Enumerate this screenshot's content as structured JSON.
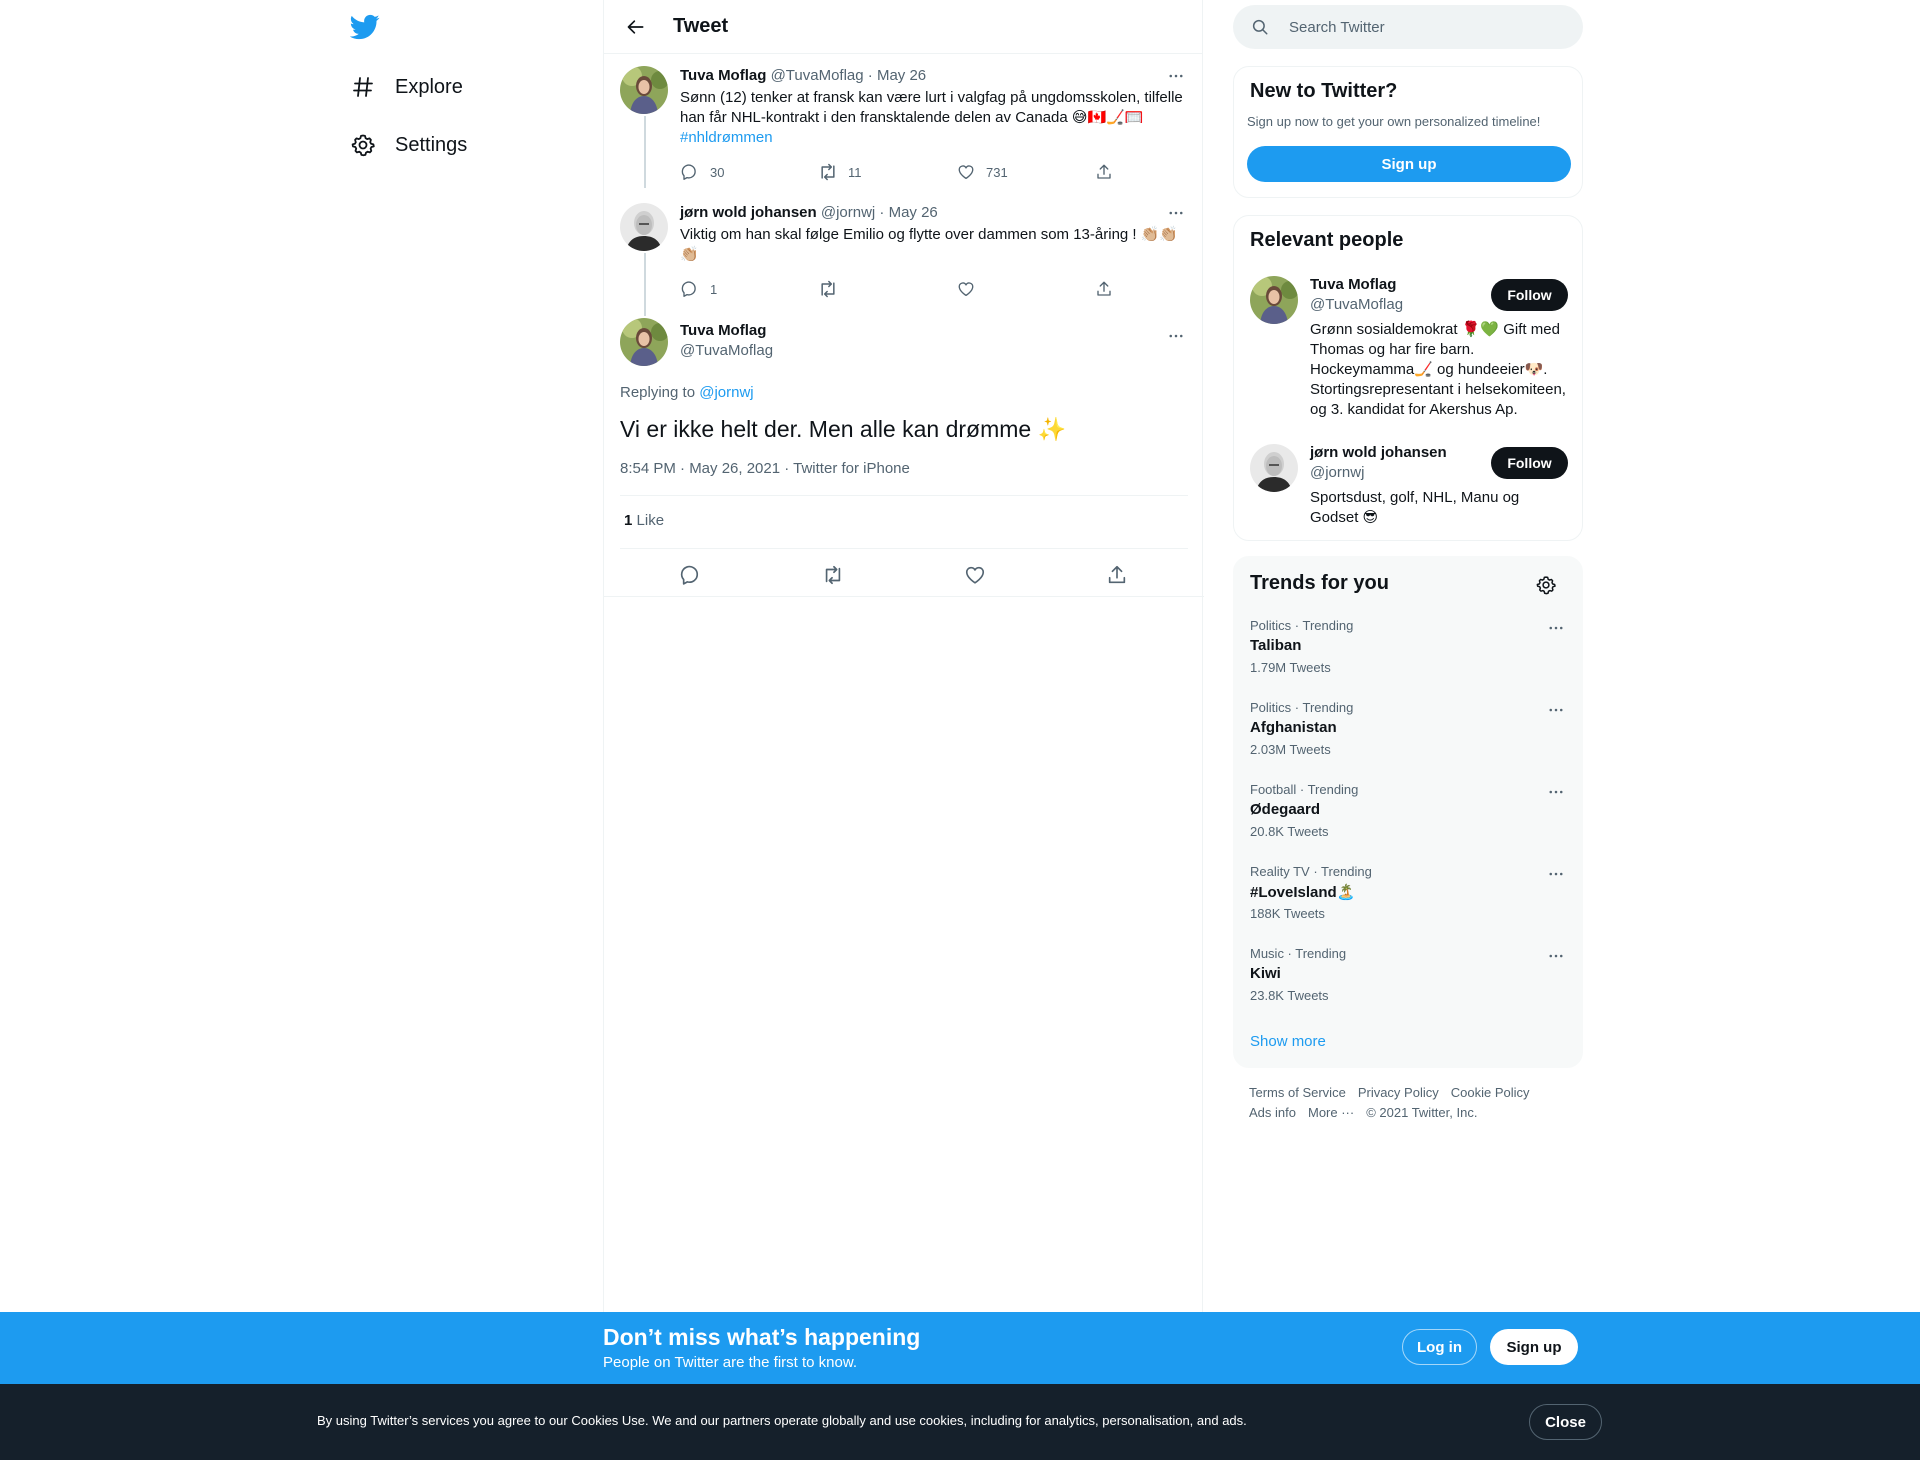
{
  "nav": {
    "logo": "twitter-bird-icon",
    "items": [
      {
        "label": "Explore",
        "icon": "hashtag-icon"
      },
      {
        "label": "Settings",
        "icon": "gear-icon"
      }
    ]
  },
  "header": {
    "title": "Tweet"
  },
  "thread": [
    {
      "name": "Tuva Moflag",
      "handle": "@TuvaMoflag",
      "date": "· May 26",
      "text_lines": [
        "Sønn (12) tenker at fransk kan være lurt i valgfag på ungdomsskolen, tilfelle",
        "han får NHL-kontrakt i den fransktalende delen av Canada 😅🇨🇦🏒🥅"
      ],
      "hashtag": "#nhldrømmen",
      "replies": "30",
      "retweets": "11",
      "likes": "731"
    },
    {
      "name": "jørn wold johansen",
      "handle": "@jornwj",
      "date": "· May 26",
      "text_lines": [
        "Viktig om han skal følge Emilio og flytte  over dammen som 13-åring ! 👏🏼👏🏼",
        "👏🏼"
      ],
      "replies": "1",
      "retweets": "",
      "likes": ""
    }
  ],
  "main_tweet": {
    "name": "Tuva Moflag",
    "handle": "@TuvaMoflag",
    "replying_prefix": "Replying to",
    "replying_to": "@jornwj",
    "text": "Vi er ikke helt der. Men alle kan drømme ✨",
    "timestamp": "8:54 PM · May 26, 2021 · Twitter for iPhone",
    "like_count": "1",
    "like_label": "Like"
  },
  "search": {
    "placeholder": "Search Twitter"
  },
  "new_to_twitter": {
    "title": "New to Twitter?",
    "subtitle": "Sign up now to get your own personalized timeline!",
    "button": "Sign up"
  },
  "relevant_people": {
    "title": "Relevant people",
    "people": [
      {
        "name": "Tuva Moflag",
        "handle": "@TuvaMoflag",
        "follow": "Follow",
        "bio_lines": [
          "Grønn sosialdemokrat 🌹💚 Gift med",
          "Thomas og har fire barn.",
          "Hockeymamma🏒 og hundeeier🐶.",
          "Stortingsrepresentant i helsekomiteen,",
          "og 3. kandidat for Akershus Ap."
        ]
      },
      {
        "name": "jørn wold johansen",
        "handle": "@jornwj",
        "follow": "Follow",
        "bio_lines": [
          "Sportsdust, golf, NHL, Manu og",
          "Godset 😎"
        ]
      }
    ]
  },
  "trends": {
    "title": "Trends for you",
    "items": [
      {
        "meta": "Politics · Trending",
        "name": "Taliban",
        "count": "1.79M Tweets"
      },
      {
        "meta": "Politics · Trending",
        "name": "Afghanistan",
        "count": "2.03M Tweets"
      },
      {
        "meta": "Football · Trending",
        "name": "Ødegaard",
        "count": "20.8K Tweets"
      },
      {
        "meta": "Reality TV · Trending",
        "name": "#LoveIsland🏝️",
        "count": "188K Tweets"
      },
      {
        "meta": "Music · Trending",
        "name": "Kiwi",
        "count": "23.8K Tweets"
      }
    ],
    "show_more": "Show more"
  },
  "footer": {
    "links": [
      "Terms of Service",
      "Privacy Policy",
      "Cookie Policy",
      "Ads info",
      "More ···",
      "© 2021 Twitter, Inc."
    ]
  },
  "signup_bar": {
    "title": "Don’t miss what’s happening",
    "subtitle": "People on Twitter are the first to know.",
    "login": "Log in",
    "signup": "Sign up"
  },
  "cookie_bar": {
    "text": "By using Twitter’s services you agree to our Cookies Use. We and our partners operate globally and use cookies, including for analytics, personalisation, and ads.",
    "close": "Close"
  },
  "colors": {
    "accent": "#1d9bf0",
    "text": "#0f1419",
    "secondary": "#536471",
    "cookie_bg": "#15202b"
  }
}
